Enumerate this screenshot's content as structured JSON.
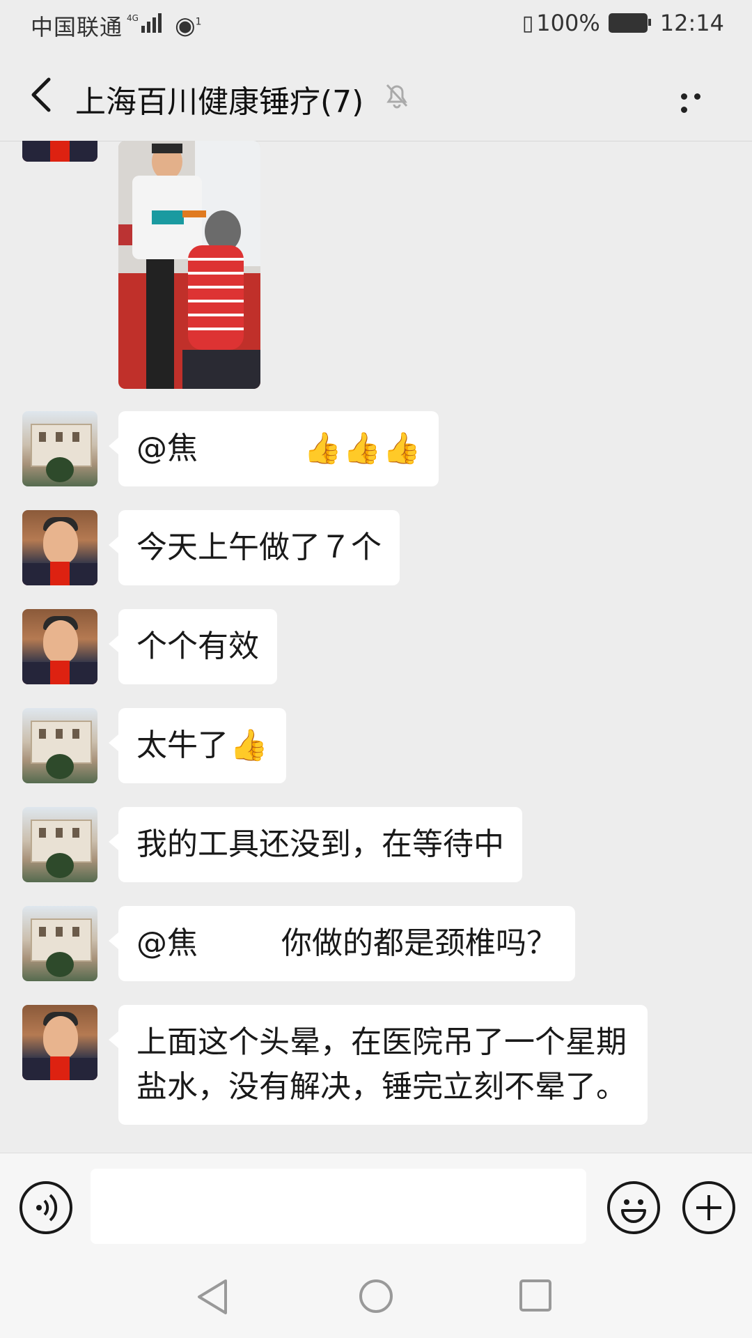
{
  "status": {
    "carrier": "中国联通",
    "network": "4G",
    "hotspot_badge": "1",
    "battery": "100%",
    "time": "12:14"
  },
  "header": {
    "title": "上海百川健康锤疗(7)"
  },
  "messages": [
    {
      "avatar": "building",
      "mention": "@焦",
      "text": ""
    },
    {
      "avatar": "man",
      "text": "今天上午做了７个"
    },
    {
      "avatar": "man",
      "text": "个个有效"
    },
    {
      "avatar": "building",
      "text": "太牛了"
    },
    {
      "avatar": "building",
      "text": "我的工具还没到，在等待中"
    },
    {
      "avatar": "building",
      "mention": "@焦",
      "text": "你做的都是颈椎吗？"
    },
    {
      "avatar": "man",
      "text": "上面这个头晕，在医院吊了一个星期盐水，没有解决，锤完立刻不晕了。"
    }
  ],
  "icons": {
    "back": "chevron-left-icon",
    "mute": "bell-off-icon",
    "more": "more-icon",
    "voice": "voice-icon",
    "emoji": "emoji-icon",
    "add": "plus-icon"
  },
  "colors": {
    "background": "#ededed",
    "bubble": "#ffffff",
    "bar": "#f6f6f6"
  }
}
